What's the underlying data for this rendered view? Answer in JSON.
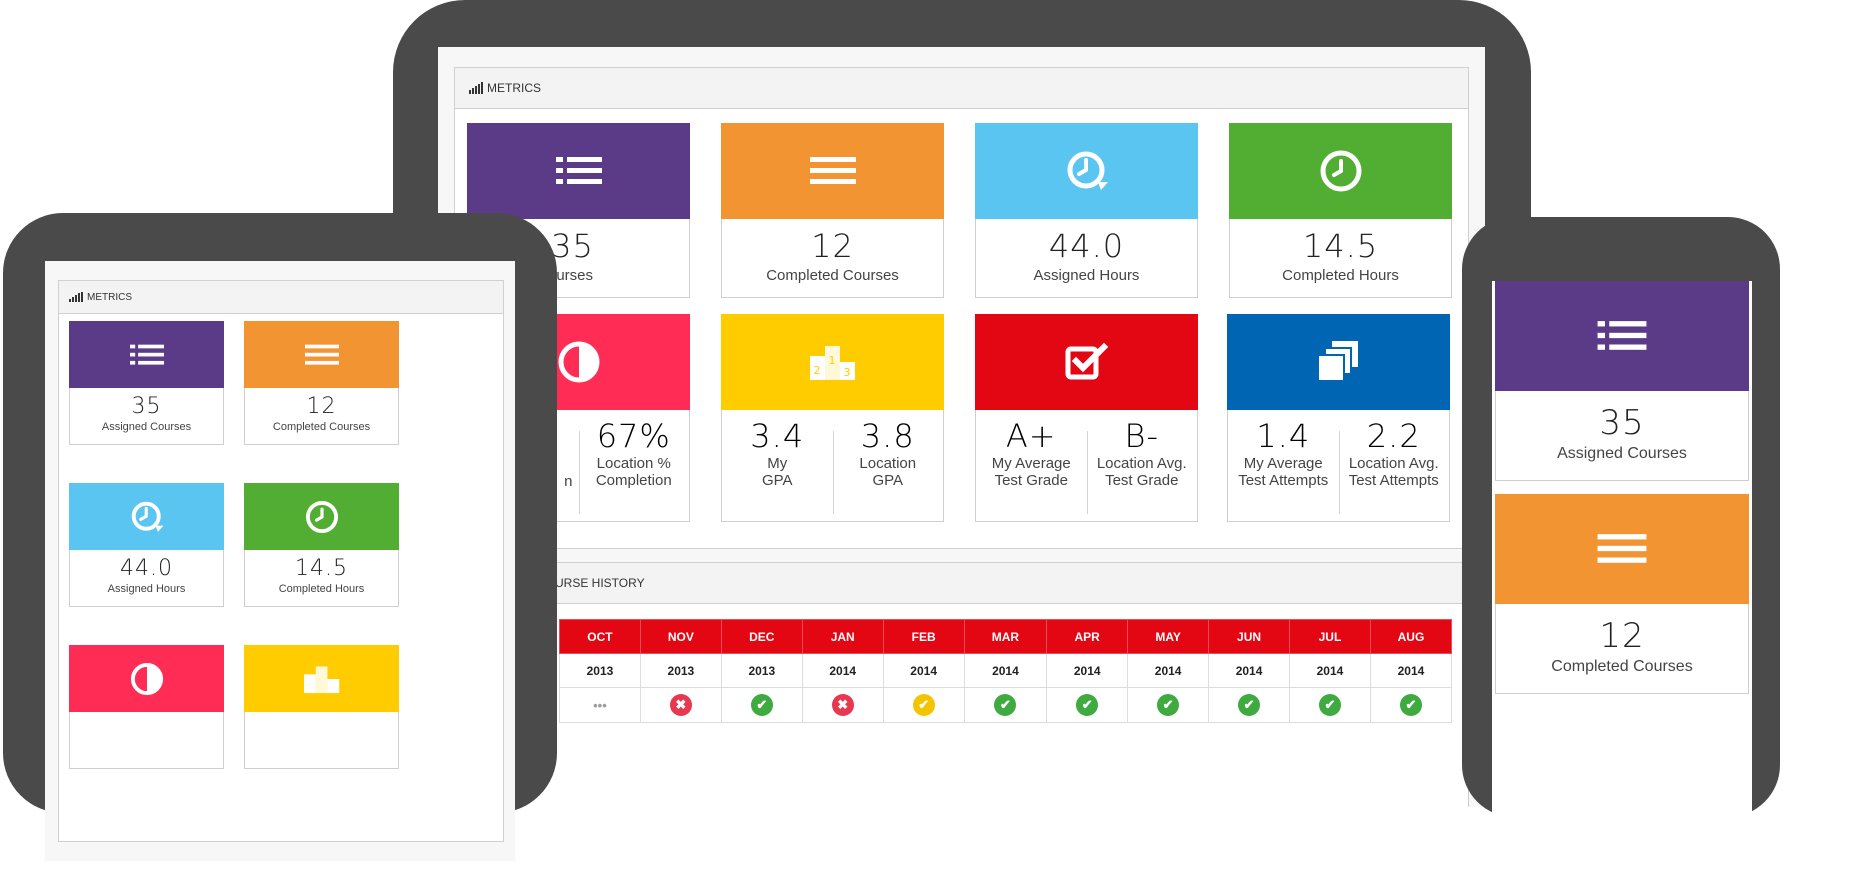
{
  "colors": {
    "purple": "#5b3a87",
    "orange": "#f39432",
    "light_blue": "#5bc5f2",
    "green": "#52ae32",
    "pink": "#ff2d55",
    "yellow": "#ffcc00",
    "red": "#e30613",
    "blue": "#0066b3",
    "status_green": "#3faa3f",
    "status_red": "#e8384f",
    "status_yellow": "#f5c400",
    "status_gray": "#9e9e9e"
  },
  "laptop": {
    "metrics_title": "METRICS",
    "cards": [
      {
        "value": "35",
        "label": "ned Courses",
        "icon": "list-icon",
        "color": "#5b3a87"
      },
      {
        "value": "12",
        "label": "Completed Courses",
        "icon": "menu-icon",
        "color": "#f39432"
      },
      {
        "value": "44.0",
        "label": "Assigned Hours",
        "icon": "clock-refresh-icon",
        "color": "#5bc5f2"
      },
      {
        "value": "14.5",
        "label": "Completed Hours",
        "icon": "clock-icon",
        "color": "#52ae32"
      }
    ],
    "split_cards": [
      {
        "icon": "half-circle-icon",
        "color": "#ff2d55",
        "left": {
          "value": "",
          "label1": "",
          "label2": "n"
        },
        "right": {
          "value": "67%",
          "label1": "Location %",
          "label2": "Completion"
        }
      },
      {
        "icon": "podium-icon",
        "color": "#ffcc00",
        "left": {
          "value": "3.4",
          "label1": "My",
          "label2": "GPA"
        },
        "right": {
          "value": "3.8",
          "label1": "Location",
          "label2": "GPA"
        }
      },
      {
        "icon": "checkbox-icon",
        "color": "#e30613",
        "left": {
          "value": "A+",
          "label1": "My Average",
          "label2": "Test Grade"
        },
        "right": {
          "value": "B-",
          "label1": "Location Avg.",
          "label2": "Test Grade"
        }
      },
      {
        "icon": "stack-icon",
        "color": "#0066b3",
        "left": {
          "value": "1.4",
          "label1": "My Average",
          "label2": "Test Attempts"
        },
        "right": {
          "value": "2.2",
          "label1": "Location Avg.",
          "label2": "Test Attempts"
        }
      }
    ],
    "history_title": "URSE HISTORY",
    "months": [
      "OCT",
      "NOV",
      "DEC",
      "JAN",
      "FEB",
      "MAR",
      "APR",
      "MAY",
      "JUN",
      "JUL",
      "AUG"
    ],
    "years": [
      "2013",
      "2013",
      "2013",
      "2014",
      "2014",
      "2014",
      "2014",
      "2014",
      "2014",
      "2014",
      "2014"
    ],
    "statuses": [
      "more",
      "fail",
      "pass",
      "fail",
      "warn",
      "pass",
      "pass",
      "pass",
      "pass",
      "pass",
      "pass"
    ]
  },
  "tablet": {
    "metrics_title": "METRICS",
    "cards": [
      {
        "value": "35",
        "label": "Assigned Courses",
        "icon": "list-icon",
        "color": "#5b3a87"
      },
      {
        "value": "12",
        "label": "Completed Courses",
        "icon": "menu-icon",
        "color": "#f39432"
      },
      {
        "value": "44.0",
        "label": "Assigned Hours",
        "icon": "clock-refresh-icon",
        "color": "#5bc5f2"
      },
      {
        "value": "14.5",
        "label": "Completed Hours",
        "icon": "clock-icon",
        "color": "#52ae32"
      },
      {
        "value": "",
        "label": "",
        "icon": "half-circle-icon",
        "color": "#ff2d55"
      },
      {
        "value": "",
        "label": "",
        "icon": "podium-icon",
        "color": "#ffcc00"
      }
    ]
  },
  "phone": {
    "cards": [
      {
        "value": "35",
        "label": "Assigned Courses",
        "icon": "list-icon",
        "color": "#5b3a87"
      },
      {
        "value": "12",
        "label": "Completed Courses",
        "icon": "menu-icon",
        "color": "#f39432"
      }
    ]
  }
}
